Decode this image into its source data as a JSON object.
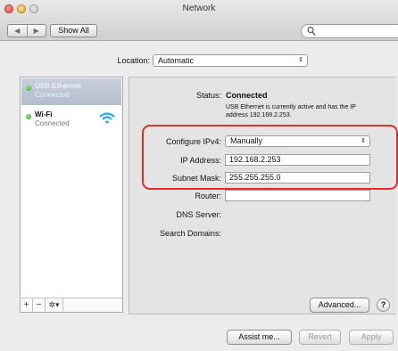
{
  "window": {
    "title": "Network"
  },
  "toolbar": {
    "back_glyph": "◀",
    "forward_glyph": "▶",
    "show_all_label": "Show All",
    "search_icon": "search-icon"
  },
  "location": {
    "label": "Location:",
    "value": "Automatic"
  },
  "sidebar": {
    "items": [
      {
        "name": "USB Ethernet",
        "status": "Connected",
        "status_color": "#29a829",
        "selected": true,
        "icon": "ethernet-icon"
      },
      {
        "name": "Wi-Fi",
        "status": "Connected",
        "status_color": "#29a829",
        "selected": false,
        "icon": "wifi-icon"
      }
    ],
    "toolbar": {
      "add": "+",
      "remove": "−",
      "gear": "✲▾"
    }
  },
  "detail": {
    "status_label": "Status:",
    "status_value": "Connected",
    "status_description": "USB Ethernet is currently active and has the IP address 192.168.2.253.",
    "configure_label": "Configure IPv4:",
    "configure_value": "Manually",
    "ip_label": "IP Address:",
    "ip_value": "192.168.2.253",
    "mask_label": "Subnet Mask:",
    "mask_value": "255.255.255.0",
    "router_label": "Router:",
    "router_value": "",
    "dns_label": "DNS Server:",
    "search_domains_label": "Search Domains:",
    "advanced_label": "Advanced...",
    "help_label": "?"
  },
  "footer": {
    "assist_label": "Assist me...",
    "revert_label": "Revert",
    "apply_label": "Apply"
  },
  "colors": {
    "highlight": "#e62b2b",
    "selected_row": "#b4bdcc",
    "connected_dot": "#29a829",
    "wifi_icon": "#2aa7e6"
  }
}
